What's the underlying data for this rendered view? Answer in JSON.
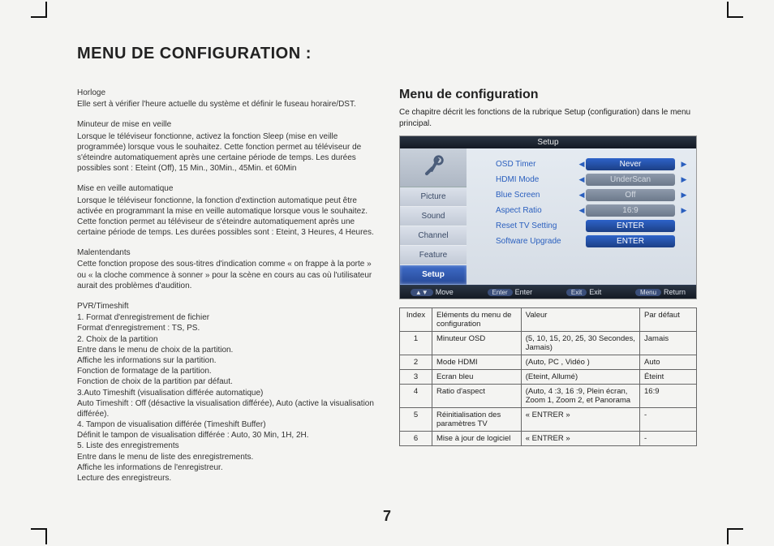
{
  "title": "MENU DE CONFIGURATION :",
  "page_number": "7",
  "left": {
    "s1_head": "Horloge",
    "s1_body": "Elle sert à vérifier l'heure actuelle du système et définir le fuseau horaire/DST.",
    "s2_head": "Minuteur de mise en veille",
    "s2_body": "Lorsque le téléviseur fonctionne, activez la fonction Sleep (mise en veille programmée) lorsque vous le souhaitez. Cette fonction permet au téléviseur de s'éteindre automatiquement après une certaine période de temps. Les durées possibles sont : Eteint (Off), 15 Min., 30Min., 45Min. et 60Min",
    "s3_head": "Mise en veille automatique",
    "s3_body": "Lorsque le téléviseur fonctionne, la fonction d'extinction automatique peut être activée en programmant la mise en veille automatique lorsque vous le souhaitez. Cette fonction permet au téléviseur de s'éteindre automatiquement après une certaine période de temps. Les durées possibles sont : Eteint, 3 Heures, 4 Heures.",
    "s4_head": "Malentendants",
    "s4_body": "Cette fonction propose des sous-titres d'indication comme « on frappe à la porte » ou « la cloche commence à sonner » pour la scène en cours au cas où l'utilisateur aurait des problèmes d'audition.",
    "s5_head": "PVR/Timeshift",
    "s5_l1": "1. Format d'enregistrement de fichier",
    "s5_l2": "Format d'enregistrement : TS, PS.",
    "s5_l3": "2. Choix de la partition",
    "s5_l4": "Entre dans le menu de choix de la partition.",
    "s5_l5": "Affiche les informations sur la partition.",
    "s5_l6": "Fonction de formatage de la partition.",
    "s5_l7": "Fonction de choix de la partition par défaut.",
    "s5_l8": "3.Auto Timeshift (visualisation différée automatique)",
    "s5_l9": "Auto Timeshift : Off (désactive la visualisation différée), Auto (active la visualisation différée).",
    "s5_l10": "4. Tampon de visualisation différée (Timeshift Buffer)",
    "s5_l11": "Définit le tampon de visualisation différée : Auto, 30 Min, 1H, 2H.",
    "s5_l12": "5. Liste des enregistrements",
    "s5_l13": "Entre dans le menu de liste des enregistrements.",
    "s5_l14": "Affiche les informations de l'enregistreur.",
    "s5_l15": "Lecture des enregistreurs."
  },
  "right": {
    "subtitle": "Menu de configuration",
    "intro": "Ce chapitre décrit les fonctions de la rubrique Setup (configuration) dans le menu principal."
  },
  "osd": {
    "title": "Setup",
    "side": [
      "Picture",
      "Sound",
      "Channel",
      "Feature",
      "Setup"
    ],
    "rows": [
      {
        "label": "OSD Timer",
        "value": "Never",
        "cls": "blue",
        "arrows": true
      },
      {
        "label": "HDMI Mode",
        "value": "UnderScan",
        "cls": "gray",
        "arrows": true
      },
      {
        "label": "Blue Screen",
        "value": "Off",
        "cls": "gray",
        "arrows": true
      },
      {
        "label": "Aspect Ratio",
        "value": "16:9",
        "cls": "gray",
        "arrows": true
      },
      {
        "label": "Reset TV Setting",
        "value": "ENTER",
        "cls": "blue",
        "arrows": false
      },
      {
        "label": "Software Upgrade",
        "value": "ENTER",
        "cls": "blue",
        "arrows": false
      }
    ],
    "foot": {
      "move_pill": "▲▼",
      "move": "Move",
      "enter_pill": "Enter",
      "enter": "Enter",
      "exit_pill": "Exit",
      "exit": "Exit",
      "return_pill": "Menu",
      "return": "Return"
    }
  },
  "table": {
    "headers": [
      "Index",
      "Eléments du menu de configuration",
      "Valeur",
      "Par défaut"
    ],
    "rows": [
      [
        "1",
        "Minuteur OSD",
        "(5, 10, 15, 20, 25, 30 Secondes, Jamais)",
        "Jamais"
      ],
      [
        "2",
        "Mode HDMI",
        "(Auto, PC , Vidéo )",
        "Auto"
      ],
      [
        "3",
        "Ecran bleu",
        "(Eteint, Allumé)",
        "Éteint"
      ],
      [
        "4",
        "Ratio d'aspect",
        "(Auto, 4 :3, 16 :9, Plein écran, Zoom 1, Zoom 2, et Panorama",
        "16:9"
      ],
      [
        "5",
        "Réinitialisation des paramètres TV",
        "« ENTRER »",
        "-"
      ],
      [
        "6",
        "Mise à jour de logiciel",
        "« ENTRER »",
        "-"
      ]
    ]
  }
}
